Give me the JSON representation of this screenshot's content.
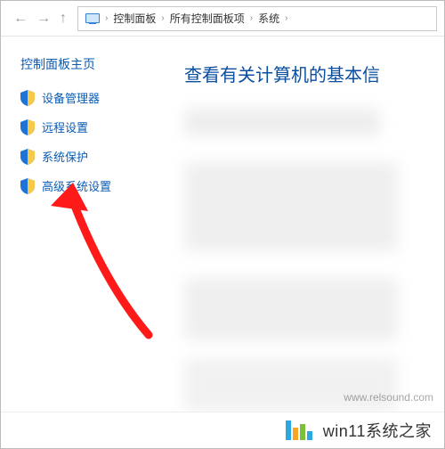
{
  "breadcrumb": {
    "items": [
      "控制面板",
      "所有控制面板项",
      "系统"
    ]
  },
  "sidebar": {
    "title": "控制面板主页",
    "links": [
      {
        "label": "设备管理器"
      },
      {
        "label": "远程设置"
      },
      {
        "label": "系统保护"
      },
      {
        "label": "高级系统设置"
      }
    ]
  },
  "main": {
    "title": "查看有关计算机的基本信"
  },
  "watermark": "www.relsound.com",
  "footer": {
    "brand": "win11系统之家"
  }
}
